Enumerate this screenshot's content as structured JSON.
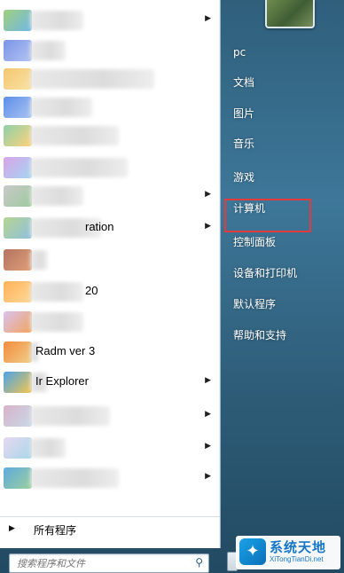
{
  "programs": [
    {
      "label": "",
      "has_arrow": true
    },
    {
      "label": "",
      "has_arrow": false
    },
    {
      "label": "",
      "has_arrow": false
    },
    {
      "label": "",
      "has_arrow": false
    },
    {
      "label": "",
      "has_arrow": false
    },
    {
      "label": "",
      "has_arrow": false
    },
    {
      "label": "",
      "has_arrow": true
    },
    {
      "label": "ration",
      "has_arrow": true
    },
    {
      "label": "",
      "has_arrow": false
    },
    {
      "label": "20",
      "has_arrow": false
    },
    {
      "label": "",
      "has_arrow": false
    },
    {
      "label": "Radm         ver 3",
      "has_arrow": false
    },
    {
      "label": "Ir             Explorer",
      "has_arrow": true
    },
    {
      "label": "",
      "has_arrow": true
    },
    {
      "label": "",
      "has_arrow": true
    },
    {
      "label": "",
      "has_arrow": true
    }
  ],
  "all_programs_label": "所有程序",
  "search": {
    "placeholder": "搜索程序和文件"
  },
  "right_menu": [
    {
      "label": "pc"
    },
    {
      "label": "文档"
    },
    {
      "label": "图片"
    },
    {
      "label": "音乐"
    },
    {
      "label": "游戏"
    },
    {
      "label": "计算机"
    },
    {
      "label": "控制面板"
    },
    {
      "label": "设备和打印机"
    },
    {
      "label": "默认程序"
    },
    {
      "label": "帮助和支持"
    }
  ],
  "highlighted_item": "控制面板",
  "highlight_color": "#e23b3b",
  "watermark": {
    "title": "系统天地",
    "url": "XiTongTianDi.net"
  }
}
